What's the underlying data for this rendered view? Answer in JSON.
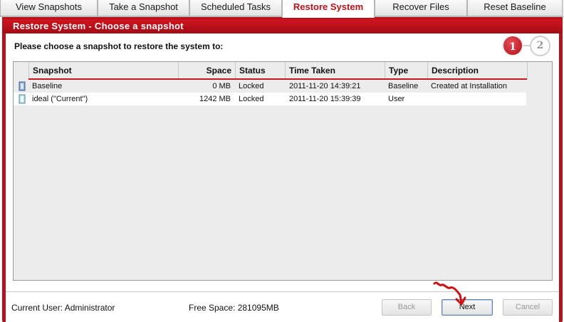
{
  "tabs": [
    {
      "label": "View Snapshots"
    },
    {
      "label": "Take a Snapshot"
    },
    {
      "label": "Scheduled Tasks"
    },
    {
      "label": "Restore System"
    },
    {
      "label": "Recover Files"
    },
    {
      "label": "Reset Baseline"
    }
  ],
  "active_tab": "Restore System",
  "header": {
    "title": "Restore System - Choose a snapshot"
  },
  "prompt": "Please choose a snapshot to restore the system to:",
  "wizard": {
    "current_step": "1",
    "next_step": "2"
  },
  "table": {
    "columns": [
      "Snapshot",
      "Space",
      "Status",
      "Time Taken",
      "Type",
      "Description"
    ],
    "rows": [
      {
        "snapshot": "Baseline",
        "space": "0 MB",
        "status": "Locked",
        "time_taken": "2011-11-20 14:39:21",
        "type": "Baseline",
        "description": "Created at Installation"
      },
      {
        "snapshot": "ideal (\"Current\")",
        "space": "1242 MB",
        "status": "Locked",
        "time_taken": "2011-11-20 15:39:39",
        "type": "User",
        "description": ""
      }
    ]
  },
  "footer": {
    "current_user": "Current User: Administrator",
    "free_space": "Free Space: 281095MB"
  },
  "buttons": {
    "back": "Back",
    "next": "Next",
    "cancel": "Cancel"
  },
  "colors": {
    "accent": "#b5121b",
    "active_tab_text": "#c10f18",
    "annotation_arrow": "#d01010"
  }
}
